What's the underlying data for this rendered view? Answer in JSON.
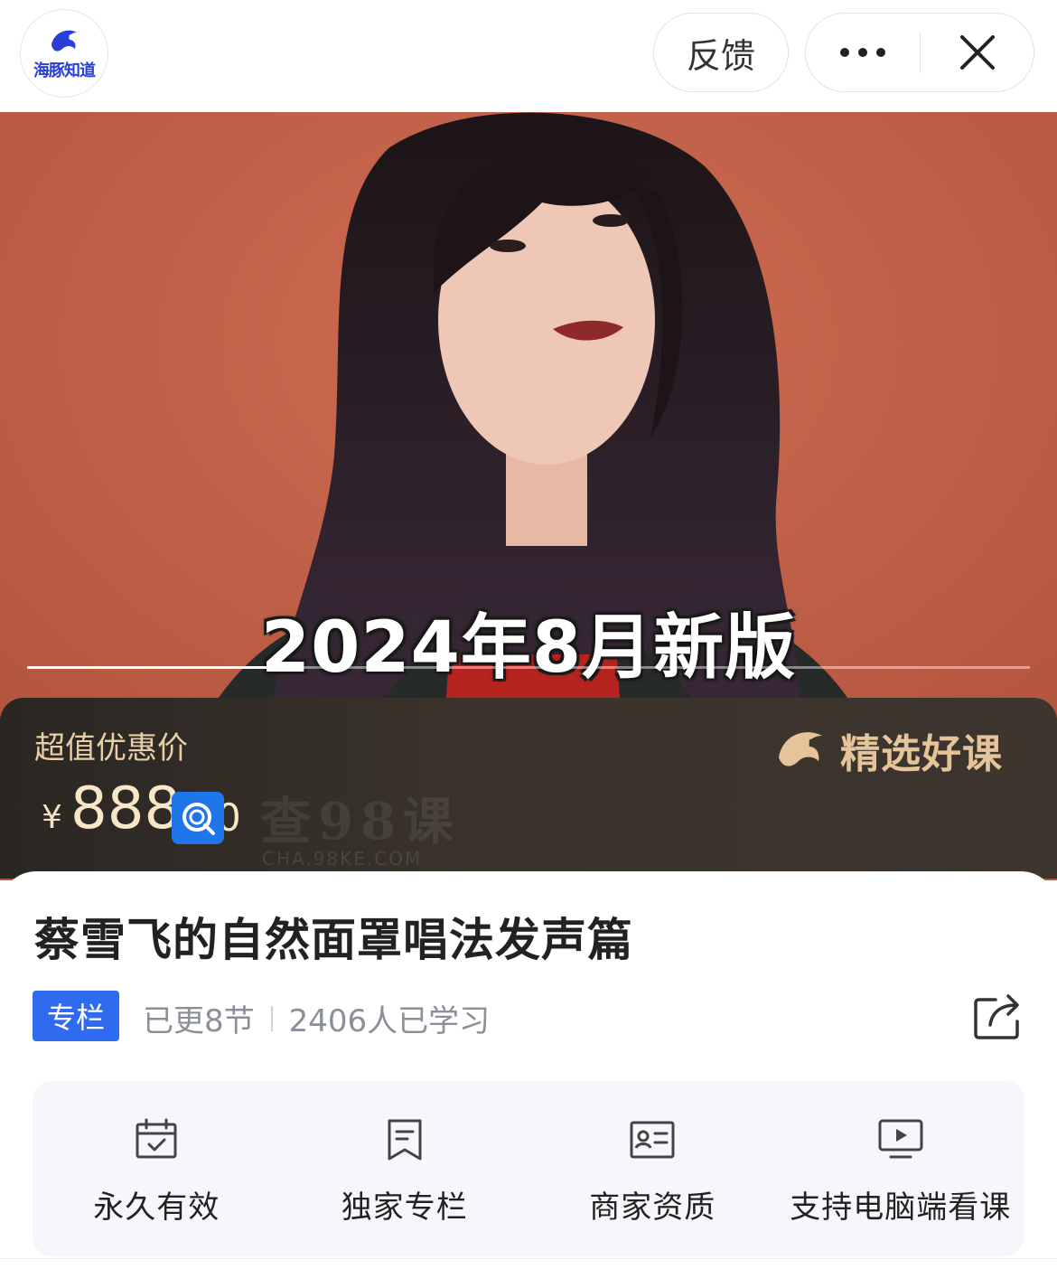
{
  "header": {
    "logo_text": "海豚知道",
    "feedback_label": "反馈",
    "more_icon": "more-dots-icon",
    "close_icon": "close-icon"
  },
  "hero": {
    "caption": "2024年8月新版",
    "video_progress": 0.24
  },
  "price_panel": {
    "label": "超值优惠价",
    "currency": "¥",
    "value": "888",
    "value_trail": "0",
    "badge_text": "精选好课",
    "watermark": "查98课",
    "watermark_sub": "CHA.98KE.COM"
  },
  "course": {
    "title": "蔡雪飞的自然面罩唱法发声篇",
    "tag": "专栏",
    "updates": "已更8节",
    "learners": "2406人已学习"
  },
  "features": [
    {
      "icon": "calendar-check-icon",
      "label": "永久有效"
    },
    {
      "icon": "bookmark-icon",
      "label": "独家专栏"
    },
    {
      "icon": "id-card-icon",
      "label": "商家资质"
    },
    {
      "icon": "monitor-play-icon",
      "label": "支持电脑端看课"
    }
  ],
  "colors": {
    "accent_blue": "#2f6bee",
    "price_gold": "#f8e6c8",
    "hero_bg": "#c2604a"
  }
}
